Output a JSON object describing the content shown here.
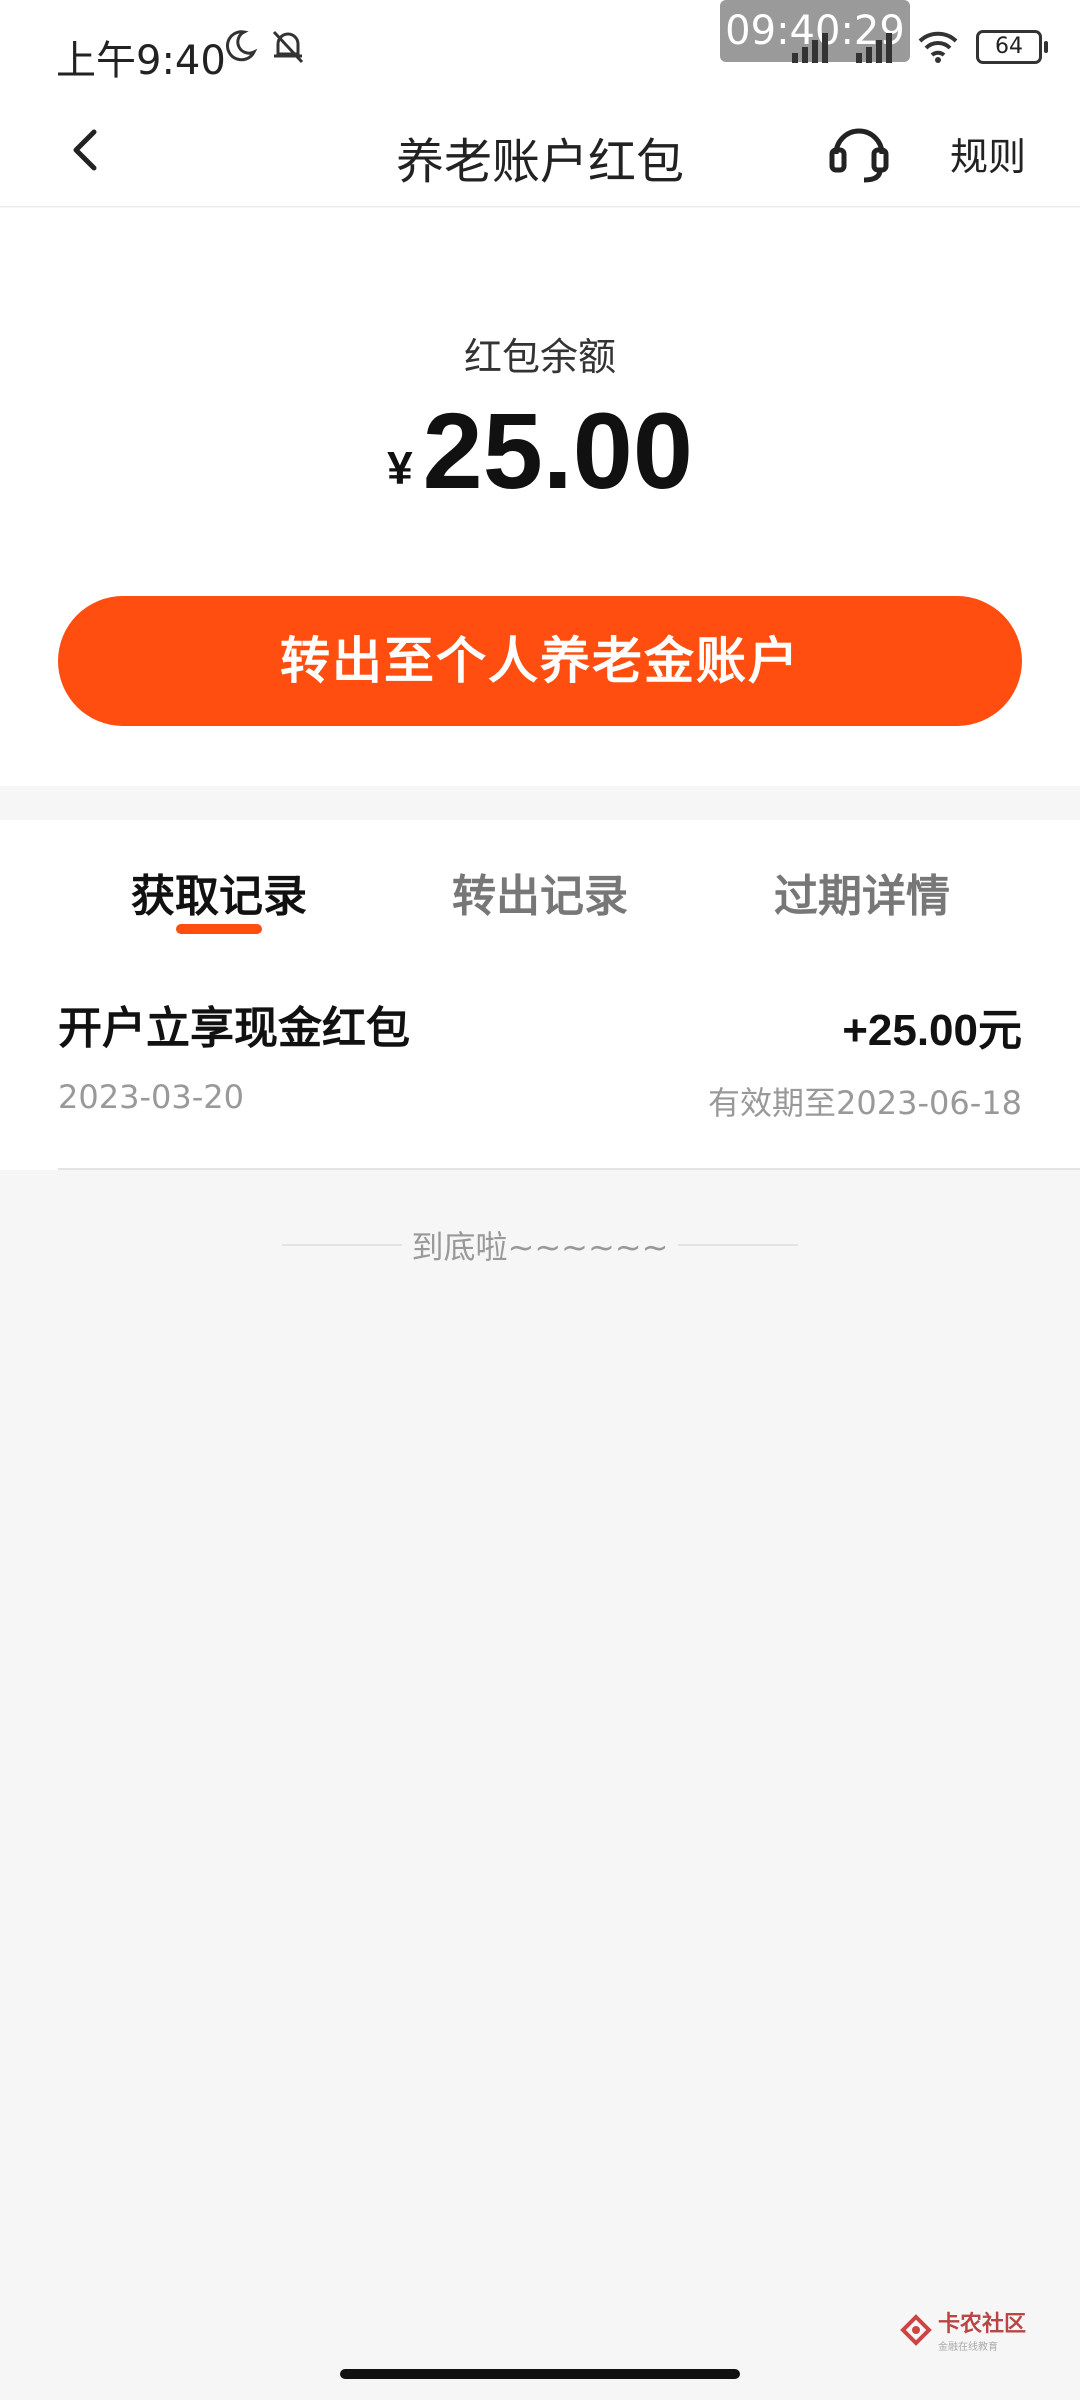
{
  "status_bar": {
    "time": "上午9:40",
    "recording_time": "09:40:29",
    "battery": "64"
  },
  "nav": {
    "title": "养老账户红包",
    "rules": "规则"
  },
  "balance": {
    "label": "红包余额",
    "currency": "¥",
    "amount": "25.00"
  },
  "transfer_button": "转出至个人养老金账户",
  "tabs": [
    {
      "label": "获取记录",
      "active": true
    },
    {
      "label": "转出记录",
      "active": false
    },
    {
      "label": "过期详情",
      "active": false
    }
  ],
  "records": [
    {
      "title": "开户立享现金红包",
      "amount": "+25.00元",
      "date": "2023-03-20",
      "expiry": "有效期至2023-06-18"
    }
  ],
  "end_text": "到底啦~~~~~~",
  "watermark": {
    "main": "卡农社区",
    "sub": "金融在线教育"
  },
  "colors": {
    "accent": "#ff4e0f"
  }
}
